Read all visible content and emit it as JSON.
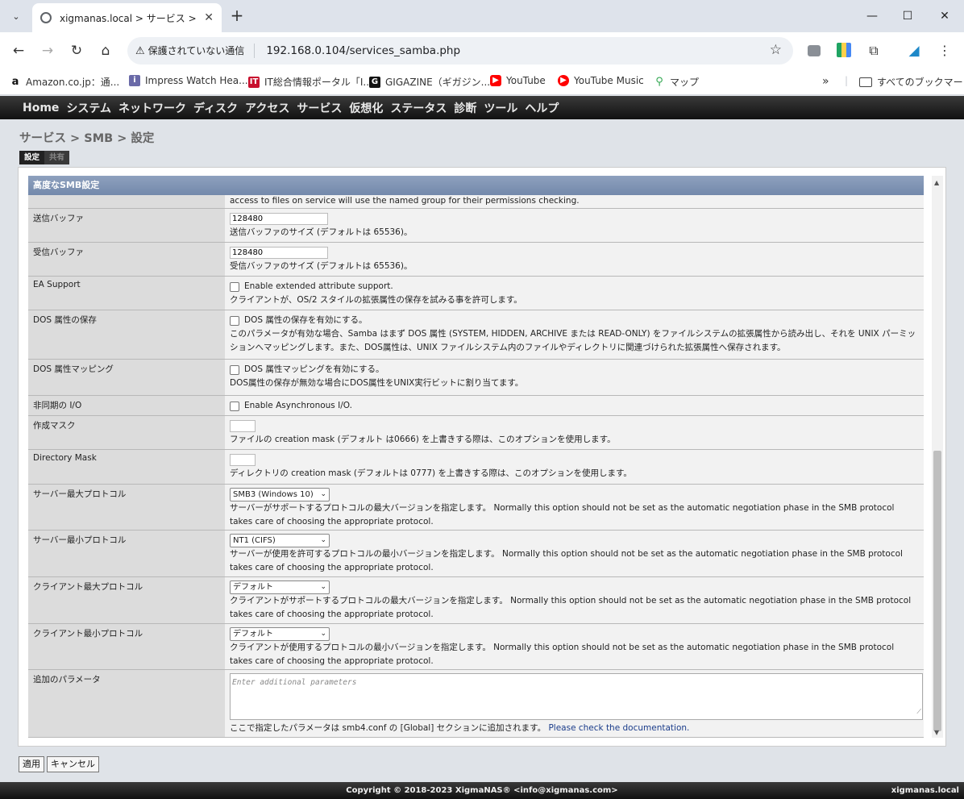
{
  "browser": {
    "tab_title": "xigmanas.local > サービス > SMB",
    "security_label": "保護されていない通信",
    "url": "192.168.0.104/services_samba.php",
    "bookmarks": [
      {
        "label": "Amazon.co.jp：通..."
      },
      {
        "label": "Impress Watch Hea..."
      },
      {
        "label": "IT総合情報ポータル「I..."
      },
      {
        "label": "GIGAZINE（ギガジン..."
      },
      {
        "label": "YouTube"
      },
      {
        "label": "YouTube Music"
      },
      {
        "label": "マップ"
      }
    ],
    "more_bookmarks": "»",
    "all_bookmarks": "すべてのブックマーク"
  },
  "nav": [
    "Home",
    "システム",
    "ネットワーク",
    "ディスク",
    "アクセス",
    "サービス",
    "仮想化",
    "ステータス",
    "診断",
    "ツール",
    "ヘルプ"
  ],
  "breadcrumb": "サービス > SMB > 設定",
  "subtabs": {
    "active": "設定",
    "inactive": "共有"
  },
  "section_title": "高度なSMB設定",
  "top_cut_text": "access to files on service will use the named group for their permissions checking.",
  "rows": {
    "send_buffer": {
      "label": "送信バッファ",
      "value": "128480",
      "desc": "送信バッファのサイズ (デフォルトは 65536)。"
    },
    "recv_buffer": {
      "label": "受信バッファ",
      "value": "128480",
      "desc": "受信バッファのサイズ (デフォルトは 65536)。"
    },
    "ea_support": {
      "label": "EA Support",
      "checkbox": "Enable extended attribute support.",
      "desc": "クライアントが、OS/2 スタイルの拡張属性の保存を試みる事を許可します。"
    },
    "dos_store": {
      "label": "DOS 属性の保存",
      "checkbox": "DOS 属性の保存を有効にする。",
      "desc": "このパラメータが有効な場合、Samba はまず DOS 属性 (SYSTEM, HIDDEN, ARCHIVE または READ-ONLY) をファイルシステムの拡張属性から読み出し、それを UNIX パーミッションへマッピングします。また、DOS属性は、UNIX ファイルシステム内のファイルやディレクトリに関連づけられた拡張属性へ保存されます。"
    },
    "dos_map": {
      "label": "DOS 属性マッピング",
      "checkbox": "DOS 属性マッピングを有効にする。",
      "desc": "DOS属性の保存が無効な場合にDOS属性をUNIX実行ビットに割り当てます。"
    },
    "async_io": {
      "label": "非同期の I/O",
      "checkbox": "Enable Asynchronous I/O."
    },
    "create_mask": {
      "label": "作成マスク",
      "value": "",
      "desc": "ファイルの creation mask (デフォルト は0666) を上書きする際は、このオプションを使用します。"
    },
    "dir_mask": {
      "label": "Directory Mask",
      "value": "",
      "desc": "ディレクトリの creation mask (デフォルトは 0777) を上書きする際は、このオプションを使用します。"
    },
    "server_max": {
      "label": "サーバー最大プロトコル",
      "selected": "SMB3 (Windows 10)",
      "desc": "サーバーがサポートするプロトコルの最大バージョンを指定します。 Normally this option should not be set as the automatic negotiation phase in the SMB protocol takes care of choosing the appropriate protocol."
    },
    "server_min": {
      "label": "サーバー最小プロトコル",
      "selected": "NT1 (CIFS)",
      "desc": "サーバーが使用を許可するプロトコルの最小バージョンを指定します。 Normally this option should not be set as the automatic negotiation phase in the SMB protocol takes care of choosing the appropriate protocol."
    },
    "client_max": {
      "label": "クライアント最大プロトコル",
      "selected": "デフォルト",
      "desc": "クライアントがサポートするプロトコルの最大バージョンを指定します。 Normally this option should not be set as the automatic negotiation phase in the SMB protocol takes care of choosing the appropriate protocol."
    },
    "client_min": {
      "label": "クライアント最小プロトコル",
      "selected": "デフォルト",
      "desc": "クライアントが使用するプロトコルの最小バージョンを指定します。 Normally this option should not be set as the automatic negotiation phase in the SMB protocol takes care of choosing the appropriate protocol."
    },
    "aux_params": {
      "label": "追加のパラメータ",
      "placeholder": "Enter additional parameters",
      "desc": "ここで指定したパラメータは smb4.conf の [Global] セクションに追加されます。",
      "link": "Please check the documentation."
    }
  },
  "buttons": {
    "apply": "適用",
    "cancel": "キャンセル"
  },
  "footer": {
    "copyright": "Copyright © 2018-2023 XigmaNAS® <info@xigmanas.com>",
    "host": "xigmanas.local"
  }
}
